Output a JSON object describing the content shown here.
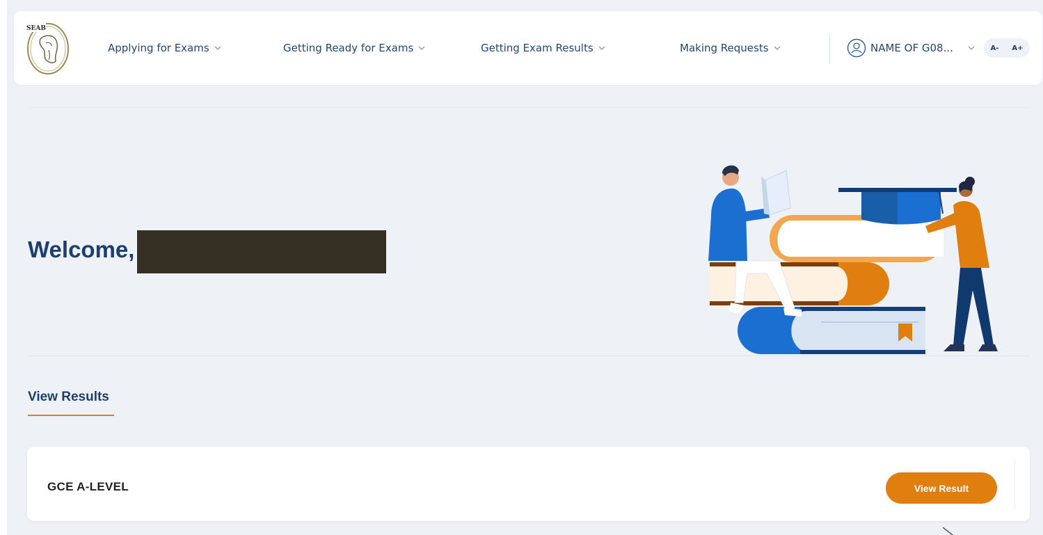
{
  "header": {
    "logo_text": "SEAB",
    "nav": [
      {
        "label": "Applying for Exams"
      },
      {
        "label": "Getting Ready for Exams"
      },
      {
        "label": "Getting Exam Results"
      },
      {
        "label": "Making Requests"
      }
    ],
    "user": {
      "label": "NAME OF G08..."
    },
    "font_controls": {
      "decrease": "A-",
      "increase": "A+"
    }
  },
  "hero": {
    "welcome": "Welcome,"
  },
  "tabs": [
    {
      "label": "View Results",
      "active": true
    }
  ],
  "results": [
    {
      "title": "GCE A-LEVEL",
      "button": "View Result"
    }
  ],
  "colors": {
    "primary": "#1d3f6e",
    "accent": "#e07e10",
    "background": "#eef1f6"
  }
}
